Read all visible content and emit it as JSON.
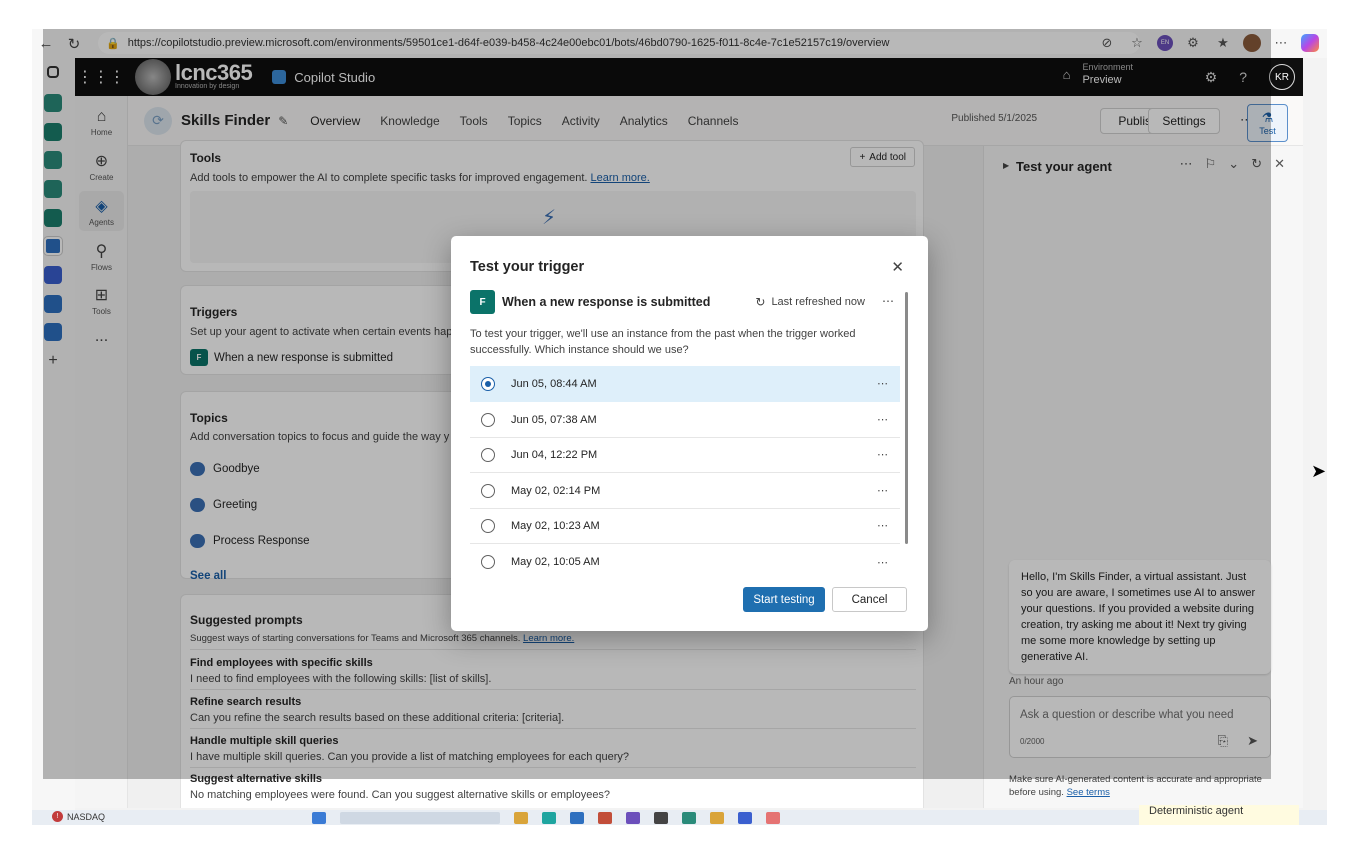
{
  "browser": {
    "url": "https://copilotstudio.preview.microsoft.com/environments/59501ce1-d64f-e039-b458-4c24e00ebc01/bots/46bd0790-1625-f011-8c4e-7c1e52157c19/overview",
    "profile_badge": "EN"
  },
  "topbar": {
    "brand": "lcnc365",
    "brand_tagline": "Innovation by design",
    "product": "Copilot Studio",
    "env_label": "Environment",
    "env_name": "Preview",
    "user_initials": "KR"
  },
  "rail": {
    "items": [
      {
        "label": "Home"
      },
      {
        "label": "Create"
      },
      {
        "label": "Agents"
      },
      {
        "label": "Flows"
      },
      {
        "label": "Tools"
      },
      {
        "label": "..."
      }
    ]
  },
  "header": {
    "agent_name": "Skills Finder",
    "tabs": [
      "Overview",
      "Knowledge",
      "Tools",
      "Topics",
      "Activity",
      "Analytics",
      "Channels"
    ],
    "published": "Published 5/1/2025",
    "publish_label": "Publish",
    "settings_label": "Settings",
    "test_label": "Test"
  },
  "main": {
    "tools": {
      "title": "Tools",
      "add_label": "Add tool",
      "description": "Add tools to empower the AI to complete specific tasks for improved engagement.",
      "learn_more": "Learn more."
    },
    "triggers": {
      "title": "Triggers",
      "description": "Set up your agent to activate when certain events hap",
      "item": "When a new response is submitted"
    },
    "topics": {
      "title": "Topics",
      "description": "Add conversation topics to focus and guide the way y",
      "items": [
        "Goodbye",
        "Greeting",
        "Process Response"
      ],
      "see_all": "See all"
    },
    "suggested": {
      "title": "Suggested prompts",
      "description": "Suggest ways of starting conversations for Teams and Microsoft 365 channels.",
      "learn_more": "Learn more.",
      "prompts": [
        {
          "title": "Find employees with specific skills",
          "text": "I need to find employees with the following skills: [list of skills]."
        },
        {
          "title": "Refine search results",
          "text": "Can you refine the search results based on these additional criteria: [criteria]."
        },
        {
          "title": "Handle multiple skill queries",
          "text": "I have multiple skill queries. Can you provide a list of matching employees for each query?"
        },
        {
          "title": "Suggest alternative skills",
          "text": "No matching employees were found. Can you suggest alternative skills or employees?"
        }
      ]
    }
  },
  "testpanel": {
    "title": "Test your agent",
    "message": "Hello, I'm Skills Finder, a virtual assistant. Just so you are aware, I sometimes use AI to answer your questions. If you provided a website during creation, try asking me about it! Next try giving me some more knowledge by setting up generative AI.",
    "message_time": "An hour ago",
    "input_placeholder": "Ask a question or describe what you need",
    "char_count": "0/2000",
    "disclaimer": "Make sure AI-generated content is accurate and appropriate before using.",
    "see_terms": "See terms"
  },
  "dialog": {
    "title": "Test your trigger",
    "trigger_name": "When a new response is submitted",
    "refresh_label": "Last refreshed now",
    "description": "To test your trigger, we'll use an instance from the past when the trigger worked successfully. Which instance should we use?",
    "instances": [
      {
        "label": "Jun 05, 08:44 AM",
        "selected": true
      },
      {
        "label": "Jun 05, 07:38 AM",
        "selected": false
      },
      {
        "label": "Jun 04, 12:22 PM",
        "selected": false
      },
      {
        "label": "May 02, 02:14 PM",
        "selected": false
      },
      {
        "label": "May 02, 10:23 AM",
        "selected": false
      },
      {
        "label": "May 02, 10:05 AM",
        "selected": false
      }
    ],
    "start_label": "Start testing",
    "cancel_label": "Cancel"
  },
  "taskbar": {
    "ticker": "NASDAQ",
    "notification": "Deterministic agent"
  },
  "colors": {
    "accent": "#1a5fa8",
    "primary_button": "#1f6fb0",
    "selected_row": "#deeffa",
    "topbar": "#0f0f0f"
  }
}
